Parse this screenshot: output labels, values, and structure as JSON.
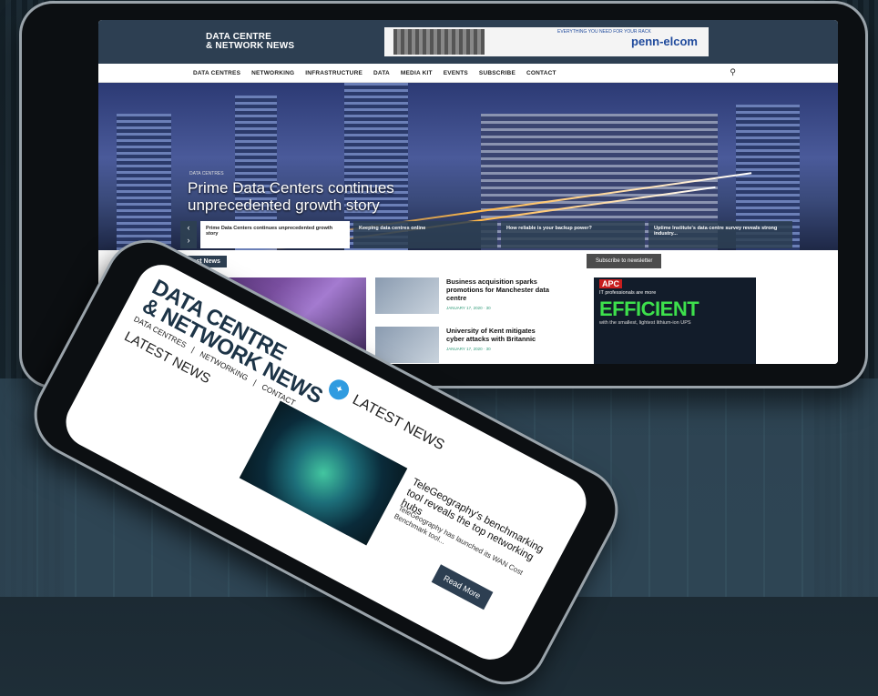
{
  "tablet": {
    "logo_line1": "DATA CENTRE",
    "logo_line2": "& NETWORK NEWS",
    "banner": {
      "brand": "penn-elcom",
      "tag": "EVERYTHING YOU NEED FOR YOUR RACK"
    },
    "nav": [
      "DATA CENTRES",
      "NETWORKING",
      "INFRASTRUCTURE",
      "DATA",
      "MEDIA KIT",
      "EVENTS",
      "SUBSCRIBE",
      "CONTACT"
    ],
    "search_icon": "search-icon",
    "hero": {
      "category": "DATA CENTRES",
      "title": "Prime Data Centers continues unprecedented growth story",
      "tabs": [
        "Prime Data Centers continues unprecedented growth story",
        "Keeping data centres online",
        "How reliable is your backup power?",
        "Uptime Institute's data centre survey reveals strong industry..."
      ]
    },
    "latest_news_label": "Latest News",
    "subscribe_label": "Subscribe to newsletter",
    "news": [
      {
        "headline": "Business acquisition sparks promotions for Manchester data centre",
        "meta": "JANUARY 17, 2020 · 30"
      },
      {
        "headline": "University of Kent mitigates cyber attacks with Britannic",
        "meta": "JANUARY 17, 2020 · 30"
      }
    ],
    "ad": {
      "logo": "APC",
      "small": "IT professionals are more",
      "big": "EFFICIENT",
      "sub": "with the smallest, lightest lithium-ion UPS"
    }
  },
  "phone": {
    "logo_line1": "DATA CENTRE",
    "logo_line2": "& NETWORK NEWS",
    "twitter_icon": "twitter-icon",
    "latest1": "LATEST NEWS",
    "nav": [
      "DATA CENTRES",
      "|",
      "NETWORKING",
      "|",
      "CONTACT"
    ],
    "latest2": "LATEST NEWS",
    "headline": "TeleGeography's benchmarking tool reveals the top networking hubs",
    "desc": "TeleGeography has launched its WAN Cost Benchmark tool...",
    "read_more": "Read More"
  }
}
